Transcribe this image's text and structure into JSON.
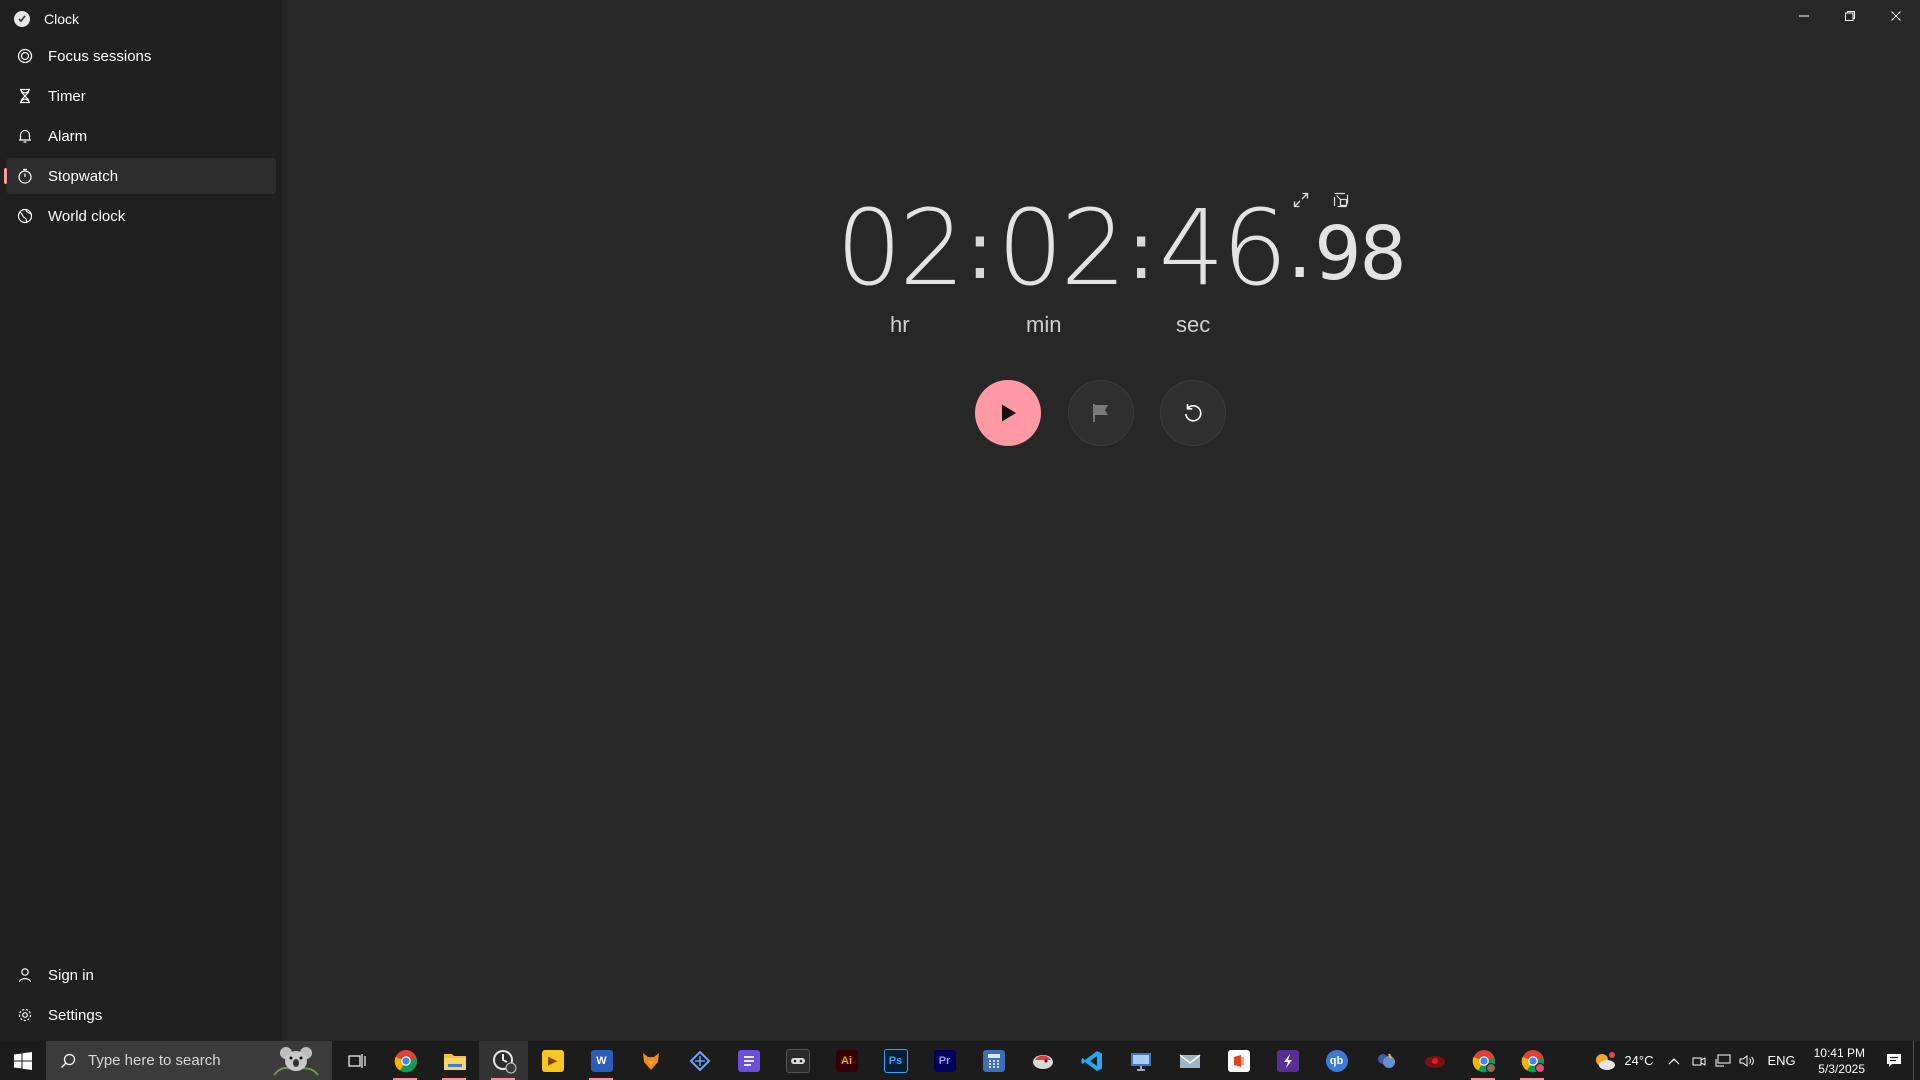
{
  "app": {
    "title": "Clock"
  },
  "nav": {
    "items": [
      {
        "label": "Focus sessions",
        "icon": "focus-icon"
      },
      {
        "label": "Timer",
        "icon": "hourglass-icon"
      },
      {
        "label": "Alarm",
        "icon": "bell-icon"
      },
      {
        "label": "Stopwatch",
        "icon": "stopwatch-icon",
        "active": true
      },
      {
        "label": "World clock",
        "icon": "globe-icon"
      }
    ],
    "sign_in": "Sign in",
    "settings": "Settings"
  },
  "stopwatch": {
    "hours": "02",
    "minutes": "02",
    "seconds": "46",
    "fraction": "98",
    "colon": ":",
    "dot": ".",
    "unit_hr": "hr",
    "unit_min": "min",
    "unit_sec": "sec",
    "state": "paused"
  },
  "taskbar": {
    "search_placeholder": "Type here to search",
    "apps": [
      {
        "name": "chrome",
        "status": "running"
      },
      {
        "name": "file-explorer",
        "status": "running"
      },
      {
        "name": "clock",
        "status": "active"
      },
      {
        "name": "pot-player",
        "status": "none"
      },
      {
        "name": "word",
        "status": "running",
        "text": "W"
      },
      {
        "name": "app-orange",
        "status": "none"
      },
      {
        "name": "app-blue",
        "status": "none"
      },
      {
        "name": "app-purple",
        "status": "none"
      },
      {
        "name": "app-dark",
        "status": "none"
      },
      {
        "name": "illustrator",
        "status": "none",
        "text": "Ai"
      },
      {
        "name": "photoshop",
        "status": "none",
        "text": "Ps"
      },
      {
        "name": "premiere",
        "status": "none",
        "text": "Pr"
      },
      {
        "name": "calculator",
        "status": "none"
      },
      {
        "name": "app-bird",
        "status": "none"
      },
      {
        "name": "vscode",
        "status": "none"
      },
      {
        "name": "app-monitor",
        "status": "none"
      },
      {
        "name": "app-mail",
        "status": "none"
      },
      {
        "name": "office",
        "status": "none"
      },
      {
        "name": "app-purple-2",
        "status": "none"
      },
      {
        "name": "qbittorrent",
        "status": "none",
        "text": "qb"
      },
      {
        "name": "app-cloud",
        "status": "none"
      },
      {
        "name": "app-red",
        "status": "none"
      },
      {
        "name": "chrome-2",
        "status": "running"
      },
      {
        "name": "chrome-3",
        "status": "running"
      }
    ],
    "weather": "24°C",
    "language": "ENG",
    "time": "10:41 PM",
    "date": "5/3/2025"
  },
  "colors": {
    "accent": "#ff99a4",
    "sidebar_bg": "#202020",
    "content_bg": "#272727",
    "taskbar_bg": "#1c1c1c"
  }
}
